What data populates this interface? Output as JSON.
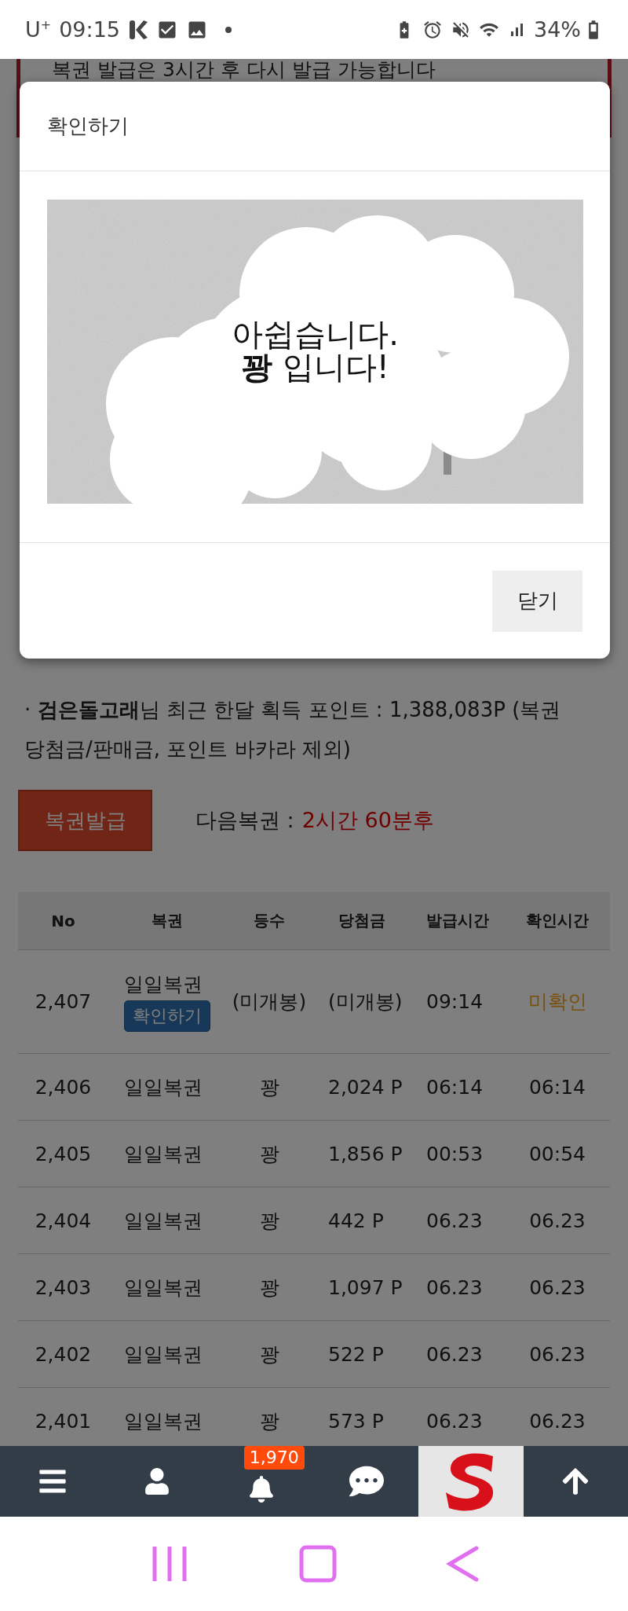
{
  "status_bar": {
    "carrier": "U$^{+}$",
    "time": "09:15",
    "battery": "34%"
  },
  "notice": {
    "text": "복권 발급은 3시간 후 다시 발급 가능합니다"
  },
  "dialog": {
    "title": "확인하기",
    "scratch_lines": [
      "아쉽습니다.",
      "**꽝** 입니다!"
    ],
    "close_button": "닫기"
  },
  "points_note": "· **검은돌고래**님 최근 한달 획득 포인트 : 1,388,083P (복권 당첨금/판매금, 포인트 바카라 제외)",
  "issue_button": "복권발급",
  "next_ticket": {
    "label": "다음복권 :",
    "value": "2시간 60분후"
  },
  "table": {
    "columns": [
      "No",
      "복권",
      "등수",
      "당첨금",
      "발급시간",
      "확인시간"
    ],
    "rows": [
      {
        "no": "2,407",
        "ticket": "일일복권",
        "action": "확인하기",
        "rank": "(미개봉)",
        "prize": "(미개봉)",
        "issued": "09:14",
        "checked": "미확인",
        "confirmed": false
      },
      {
        "no": "2,406",
        "ticket": "일일복권",
        "rank": "꽝",
        "prize": "2,024 P",
        "issued": "06:14",
        "checked": "06:14",
        "confirmed": true
      },
      {
        "no": "2,405",
        "ticket": "일일복권",
        "rank": "꽝",
        "prize": "1,856 P",
        "issued": "00:53",
        "checked": "00:54",
        "confirmed": true
      },
      {
        "no": "2,404",
        "ticket": "일일복권",
        "rank": "꽝",
        "prize": "442 P",
        "issued": "06.23",
        "checked": "06.23",
        "confirmed": true
      },
      {
        "no": "2,403",
        "ticket": "일일복권",
        "rank": "꽝",
        "prize": "1,097 P",
        "issued": "06.23",
        "checked": "06.23",
        "confirmed": true
      },
      {
        "no": "2,402",
        "ticket": "일일복권",
        "rank": "꽝",
        "prize": "522 P",
        "issued": "06.23",
        "checked": "06.23",
        "confirmed": true
      },
      {
        "no": "2,401",
        "ticket": "일일복권",
        "rank": "꽝",
        "prize": "573 P",
        "issued": "06.23",
        "checked": "06.23",
        "confirmed": true
      }
    ]
  },
  "bottom_nav": {
    "items": [
      {
        "kind": "menu"
      },
      {
        "kind": "user"
      },
      {
        "kind": "bell",
        "badge": "1,970"
      },
      {
        "kind": "chat"
      },
      {
        "kind": "logo"
      },
      {
        "kind": "top"
      }
    ]
  }
}
